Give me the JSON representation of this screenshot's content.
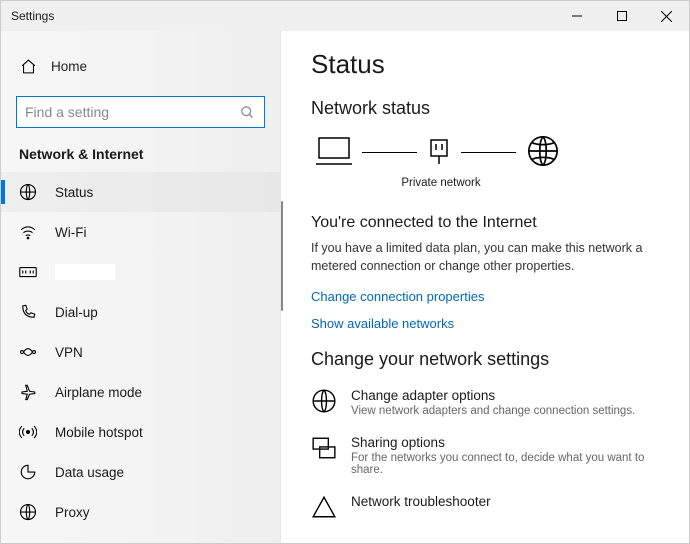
{
  "titlebar": {
    "title": "Settings"
  },
  "sidebar": {
    "home": "Home",
    "searchPlaceholder": "Find a setting",
    "category": "Network & Internet",
    "items": [
      {
        "label": "Status"
      },
      {
        "label": "Wi-Fi"
      },
      {
        "label": ""
      },
      {
        "label": "Dial-up"
      },
      {
        "label": "VPN"
      },
      {
        "label": "Airplane mode"
      },
      {
        "label": "Mobile hotspot"
      },
      {
        "label": "Data usage"
      },
      {
        "label": "Proxy"
      }
    ]
  },
  "main": {
    "title": "Status",
    "subtitle": "Network status",
    "caption": "Private network",
    "connectedHeading": "You're connected to the Internet",
    "connectedBody": "If you have a limited data plan, you can make this network a metered connection or change other properties.",
    "link1": "Change connection properties",
    "link2": "Show available networks",
    "changeHeading": "Change your network settings",
    "options": [
      {
        "title": "Change adapter options",
        "sub": "View network adapters and change connection settings."
      },
      {
        "title": "Sharing options",
        "sub": "For the networks you connect to, decide what you want to share."
      },
      {
        "title": "Network troubleshooter",
        "sub": ""
      }
    ]
  }
}
